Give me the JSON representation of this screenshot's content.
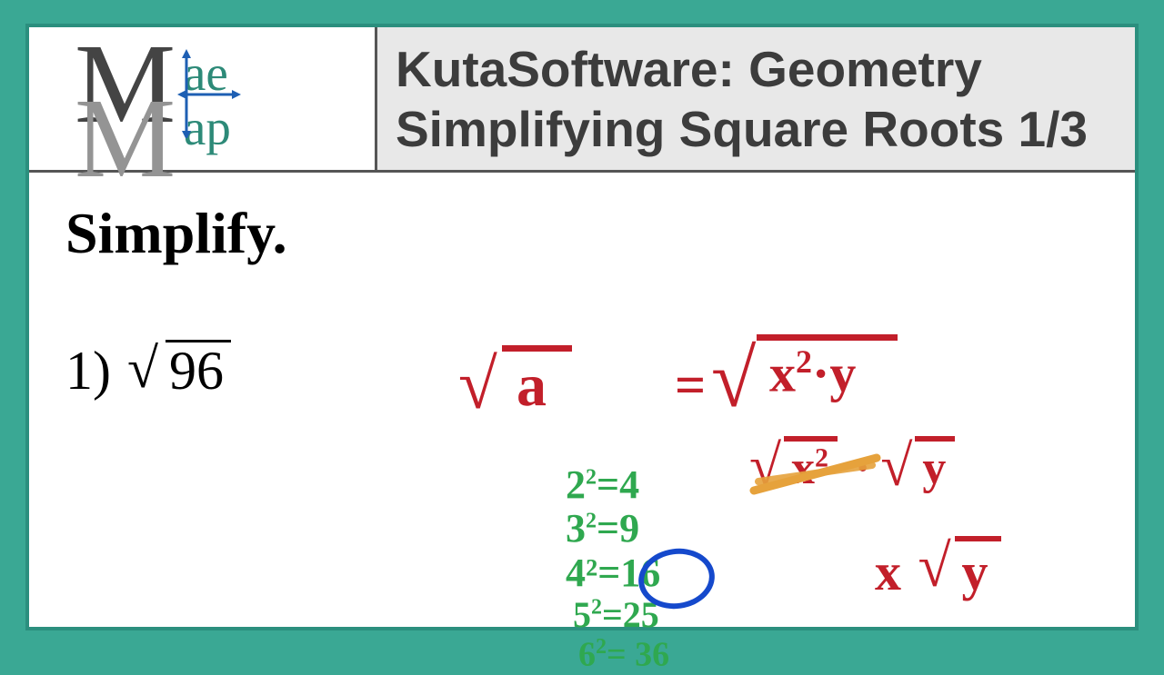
{
  "logo": {
    "letter1": "M",
    "letter2": "M",
    "suffix1": "ae",
    "suffix2": "ap"
  },
  "title": {
    "line1": "KutaSoftware: Geometry",
    "line2": "Simplifying Square Roots 1/3"
  },
  "instruction": "Simplify.",
  "problem": {
    "number": "1)",
    "radicand": "96"
  },
  "work": {
    "sqrt_a": "a",
    "equals": "=",
    "sqrt_xy_x": "x",
    "sqrt_xy_exp": "2",
    "sqrt_xy_dot": "·",
    "sqrt_xy_y": "y",
    "step2_x": "x",
    "step2_exp": "2",
    "step2_dot": "·",
    "step2_y": "y",
    "final_x": "x",
    "final_y": "y",
    "squares": {
      "r1": "2²=4",
      "r2": "3²=9",
      "r3_l": "4²=",
      "r3_r": "16",
      "r4": "5²=25",
      "r5": "6²= 36"
    }
  },
  "colors": {
    "red": "#c21f2a",
    "green": "#2fa84f",
    "blue": "#1549cc",
    "teal": "#3aa894",
    "orange": "#e6a23c"
  }
}
